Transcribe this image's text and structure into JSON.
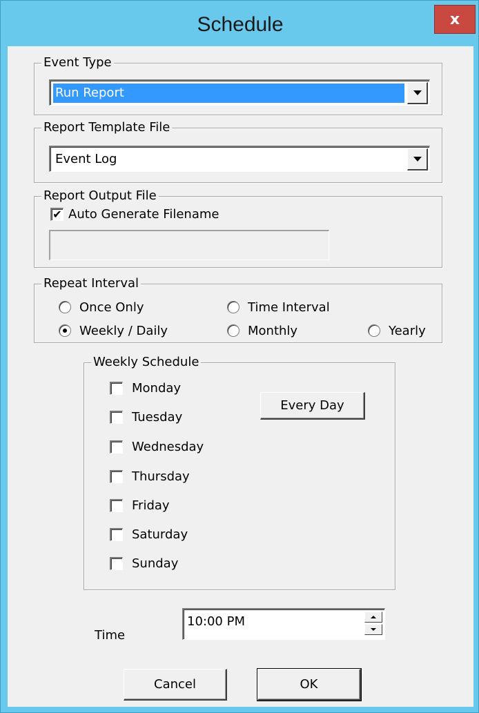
{
  "window": {
    "title": "Schedule",
    "close_label": "x"
  },
  "event_type": {
    "group_label": "Event Type",
    "selected": "Run Report"
  },
  "report_template": {
    "group_label": "Report Template File",
    "selected": "Event Log"
  },
  "report_output": {
    "group_label": "Report Output File",
    "auto_generate_label": "Auto Generate Filename",
    "auto_generate_checked": true,
    "filename_value": ""
  },
  "repeat_interval": {
    "group_label": "Repeat Interval",
    "options": {
      "once_only": "Once Only",
      "time_interval": "Time Interval",
      "weekly_daily": "Weekly / Daily",
      "monthly": "Monthly",
      "yearly": "Yearly"
    },
    "selected": "Weekly / Daily"
  },
  "weekly_schedule": {
    "group_label": "Weekly Schedule",
    "days": [
      "Monday",
      "Tuesday",
      "Wednesday",
      "Thursday",
      "Friday",
      "Saturday",
      "Sunday"
    ],
    "every_day_label": "Every Day"
  },
  "time": {
    "label": "Time",
    "value": "10:00 PM"
  },
  "buttons": {
    "cancel": "Cancel",
    "ok": "OK"
  },
  "colors": {
    "title_bar": "#69c9ed",
    "close": "#c9483f",
    "selection": "#3399ff",
    "dialog_bg": "#f0f0f0"
  }
}
